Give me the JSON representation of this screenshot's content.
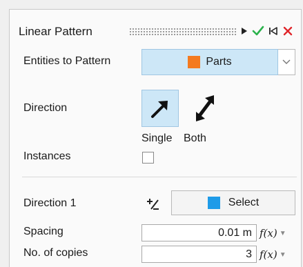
{
  "header": {
    "title": "Linear Pattern",
    "icons": [
      "run-icon",
      "check-icon",
      "skip-back-icon",
      "close-icon"
    ]
  },
  "entities": {
    "label": "Entities to Pattern",
    "button_label": "Parts",
    "swatch_color": "#f47a20"
  },
  "direction": {
    "label": "Direction",
    "single_label": "Single",
    "both_label": "Both",
    "selected": "Single"
  },
  "instances": {
    "label": "Instances",
    "checked": false
  },
  "direction1": {
    "label": "Direction 1",
    "button_label": "Select",
    "swatch_color": "#1e9be8"
  },
  "spacing": {
    "label": "Spacing",
    "value": "0.01 m",
    "fx_label": "f(x)"
  },
  "copies": {
    "label": "No. of copies",
    "value": "3",
    "fx_label": "f(x)"
  },
  "colors": {
    "accent_bg": "#cde7f7",
    "check": "#2bb24c",
    "close": "#e0262b"
  }
}
